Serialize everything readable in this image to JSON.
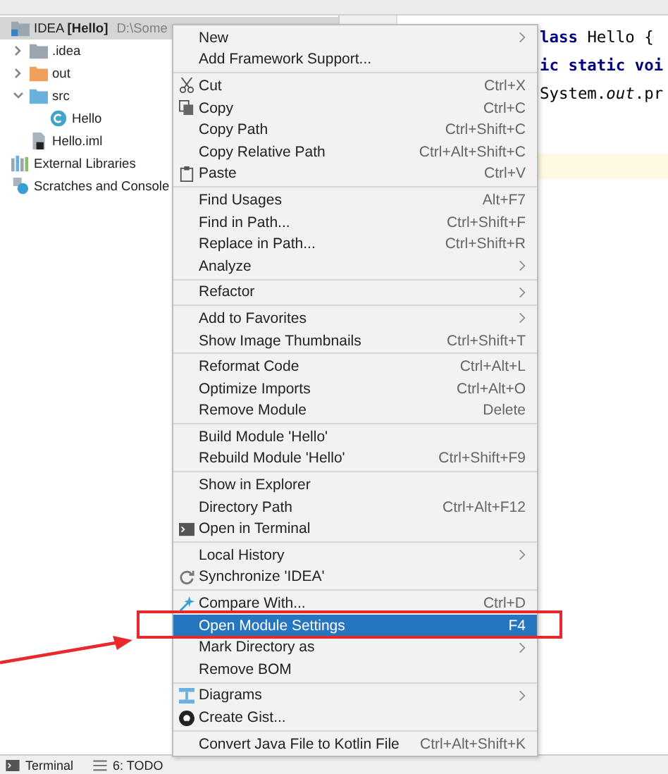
{
  "project_tree": [
    {
      "label": "IDEA **[Hello]**",
      "path": "D:\\Some",
      "kind": "module",
      "selected": true,
      "children": [
        {
          "label": ".idea",
          "kind": "folder",
          "expanded": false,
          "selected": false
        },
        {
          "label": "out",
          "kind": "excluded-folder",
          "expanded": false,
          "selected": false
        },
        {
          "label": "src",
          "kind": "source-folder",
          "expanded": true,
          "selected": false,
          "children": [
            {
              "label": "Hello",
              "kind": "class",
              "selected": false
            }
          ]
        },
        {
          "label": "Hello.iml",
          "kind": "module-file",
          "selected": false
        }
      ]
    },
    {
      "label": "External Libraries",
      "kind": "libraries",
      "selected": false
    },
    {
      "label": "Scratches and Console",
      "kind": "scratches",
      "selected": false
    }
  ],
  "editor": {
    "lines": [
      "**lass** Hello {",
      "**ic static voi**",
      "System.*out*.pr"
    ]
  },
  "context_menu": [
    [
      {
        "label": "New",
        "submenu": true,
        "selected": false
      },
      {
        "label": "Add Framework Support...",
        "selected": false
      }
    ],
    [
      {
        "label": "Cut",
        "shortcut": "Ctrl+X",
        "selected": false
      },
      {
        "label": "Copy",
        "shortcut": "Ctrl+C",
        "selected": false
      },
      {
        "label": "Copy Path",
        "shortcut": "Ctrl+Shift+C",
        "selected": false
      },
      {
        "label": "Copy Relative Path",
        "shortcut": "Ctrl+Alt+Shift+C",
        "selected": false
      },
      {
        "label": "Paste",
        "shortcut": "Ctrl+V",
        "selected": false
      }
    ],
    [
      {
        "label": "Find Usages",
        "shortcut": "Alt+F7",
        "selected": false
      },
      {
        "label": "Find in Path...",
        "shortcut": "Ctrl+Shift+F",
        "selected": false
      },
      {
        "label": "Replace in Path...",
        "shortcut": "Ctrl+Shift+R",
        "selected": false
      },
      {
        "label": "Analyze",
        "submenu": true,
        "selected": false
      }
    ],
    [
      {
        "label": "Refactor",
        "submenu": true,
        "selected": false
      }
    ],
    [
      {
        "label": "Add to Favorites",
        "submenu": true,
        "selected": false
      },
      {
        "label": "Show Image Thumbnails",
        "shortcut": "Ctrl+Shift+T",
        "selected": false
      }
    ],
    [
      {
        "label": "Reformat Code",
        "shortcut": "Ctrl+Alt+L",
        "selected": false
      },
      {
        "label": "Optimize Imports",
        "shortcut": "Ctrl+Alt+O",
        "selected": false
      },
      {
        "label": "Remove Module",
        "shortcut": "Delete",
        "selected": false
      }
    ],
    [
      {
        "label": "Build Module 'Hello'",
        "selected": false
      },
      {
        "label": "Rebuild Module 'Hello'",
        "shortcut": "Ctrl+Shift+F9",
        "selected": false
      }
    ],
    [
      {
        "label": "Show in Explorer",
        "selected": false
      },
      {
        "label": "Directory Path",
        "shortcut": "Ctrl+Alt+F12",
        "selected": false
      },
      {
        "label": "Open in Terminal",
        "selected": false
      }
    ],
    [
      {
        "label": "Local History",
        "submenu": true,
        "selected": false
      },
      {
        "label": "Synchronize 'IDEA'",
        "selected": false
      }
    ],
    [
      {
        "label": "Compare With...",
        "shortcut": "Ctrl+D",
        "selected": false
      },
      {
        "label": "Open Module Settings",
        "shortcut": "F4",
        "selected": true
      },
      {
        "label": "Mark Directory as",
        "submenu": true,
        "selected": false
      },
      {
        "label": "Remove BOM",
        "selected": false
      }
    ],
    [
      {
        "label": "Diagrams",
        "submenu": true,
        "selected": false
      },
      {
        "label": "Create Gist...",
        "selected": false
      }
    ],
    [
      {
        "label": "Convert Java File to Kotlin File",
        "shortcut": "Ctrl+Alt+Shift+K",
        "selected": false
      }
    ]
  ],
  "status_bar": [
    "Terminal",
    "6: TODO"
  ]
}
